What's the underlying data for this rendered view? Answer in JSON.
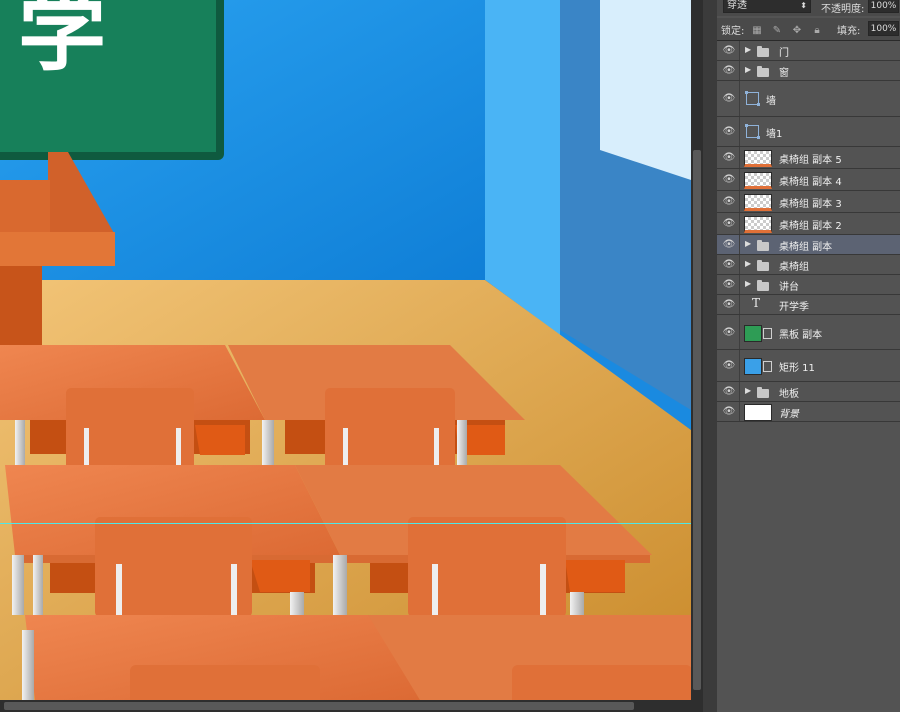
{
  "canvas": {
    "chalkboard_char": "学"
  },
  "layers_panel": {
    "blend_mode": "穿透",
    "opacity_label": "不透明度:",
    "opacity_value": "100%",
    "lock_label": "锁定:",
    "lock_icons": [
      "transparency-lock-icon",
      "brush-lock-icon",
      "move-lock-icon",
      "padlock-icon"
    ],
    "fill_label": "填充:",
    "fill_value": "100%",
    "layers": [
      {
        "name": "门",
        "kind": "group",
        "expanded": false,
        "visible": true,
        "selected": false
      },
      {
        "name": "窗",
        "kind": "group",
        "expanded": false,
        "visible": true,
        "selected": false
      },
      {
        "name": "墙",
        "kind": "shape",
        "visible": true,
        "selected": false
      },
      {
        "name": "墙1",
        "kind": "shape",
        "visible": true,
        "selected": false
      },
      {
        "name": "桌椅组 副本 5",
        "kind": "smart",
        "visible": true,
        "selected": false
      },
      {
        "name": "桌椅组 副本 4",
        "kind": "smart",
        "visible": true,
        "selected": false
      },
      {
        "name": "桌椅组 副本 3",
        "kind": "smart",
        "visible": true,
        "selected": false
      },
      {
        "name": "桌椅组 副本 2",
        "kind": "smart",
        "visible": true,
        "selected": false
      },
      {
        "name": "桌椅组 副本",
        "kind": "group",
        "expanded": false,
        "visible": true,
        "selected": true
      },
      {
        "name": "桌椅组",
        "kind": "group",
        "expanded": false,
        "visible": true,
        "selected": false
      },
      {
        "name": "讲台",
        "kind": "group",
        "expanded": false,
        "visible": true,
        "selected": false
      },
      {
        "name": "开学季",
        "kind": "text",
        "visible": true,
        "selected": false
      },
      {
        "name": "黑板 副本",
        "kind": "raster-green",
        "visible": true,
        "selected": false
      },
      {
        "name": "矩形 11",
        "kind": "raster-blue",
        "visible": true,
        "selected": false
      },
      {
        "name": "地板",
        "kind": "group",
        "expanded": false,
        "visible": true,
        "selected": false
      },
      {
        "name": "背景",
        "kind": "background",
        "visible": true,
        "selected": false
      }
    ]
  },
  "colors": {
    "wall": "#1e8fe0",
    "floor": "#d9a046",
    "desk": "#e0703a",
    "chalkboard": "#1a7a55",
    "panel_bg": "#535353",
    "selected_row": "#5c6373"
  }
}
